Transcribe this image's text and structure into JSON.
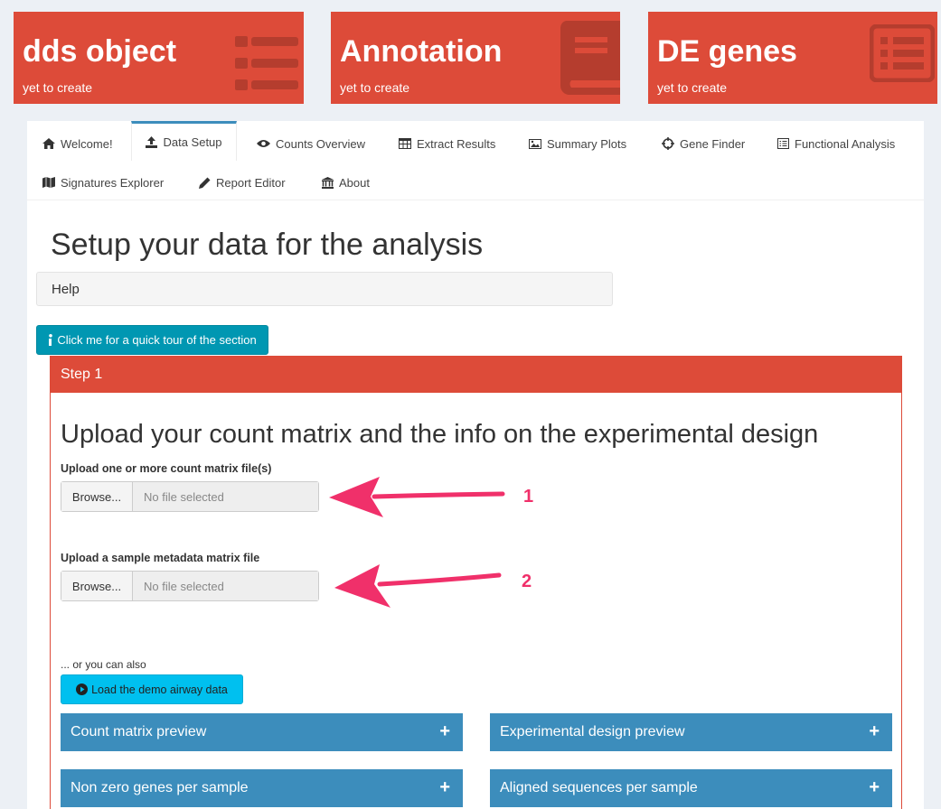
{
  "value_boxes": [
    {
      "title": "dds object",
      "subtitle": "yet to create",
      "icon": "list-icon"
    },
    {
      "title": "Annotation",
      "subtitle": "yet to create",
      "icon": "book-icon"
    },
    {
      "title": "DE genes",
      "subtitle": "yet to create",
      "icon": "list-alt-icon"
    }
  ],
  "tabs": [
    {
      "label": "Welcome!",
      "icon": "home-icon",
      "active": false
    },
    {
      "label": "Data Setup",
      "icon": "upload-icon",
      "active": true
    },
    {
      "label": "Counts Overview",
      "icon": "eye-icon",
      "active": false
    },
    {
      "label": "Extract Results",
      "icon": "table-icon",
      "active": false
    },
    {
      "label": "Summary Plots",
      "icon": "image-icon",
      "active": false
    },
    {
      "label": "Gene Finder",
      "icon": "crosshairs-icon",
      "active": false
    },
    {
      "label": "Functional Analysis",
      "icon": "list-alt-icon",
      "active": false
    },
    {
      "label": "Signatures Explorer",
      "icon": "map-icon",
      "active": false
    },
    {
      "label": "Report Editor",
      "icon": "pencil-icon",
      "active": false
    },
    {
      "label": "About",
      "icon": "institution-icon",
      "active": false
    }
  ],
  "page_title": "Setup your data for the analysis",
  "help_label": "Help",
  "tour_button": "Click me for a quick tour of the section",
  "step": {
    "title": "Step 1",
    "heading": "Upload your count matrix and the info on the experimental design",
    "uploads": [
      {
        "label": "Upload one or more count matrix file(s)",
        "button": "Browse...",
        "placeholder": "No file selected",
        "annotation": "1"
      },
      {
        "label": "Upload a sample metadata matrix file",
        "button": "Browse...",
        "placeholder": "No file selected",
        "annotation": "2"
      }
    ],
    "also_text": "... or you can also",
    "demo_button": "Load the demo airway data",
    "collapsible_boxes": [
      {
        "title": "Count matrix preview",
        "toggle": "+"
      },
      {
        "title": "Experimental design preview",
        "toggle": "+"
      },
      {
        "title": "Non zero genes per sample",
        "toggle": "+"
      },
      {
        "title": "Aligned sequences per sample",
        "toggle": "+"
      }
    ]
  },
  "colors": {
    "red": "#dd4b39",
    "blue": "#3c8dbc",
    "teal": "#0097b2",
    "aqua": "#00c0ef",
    "annotation_pink": "#f0306a"
  }
}
